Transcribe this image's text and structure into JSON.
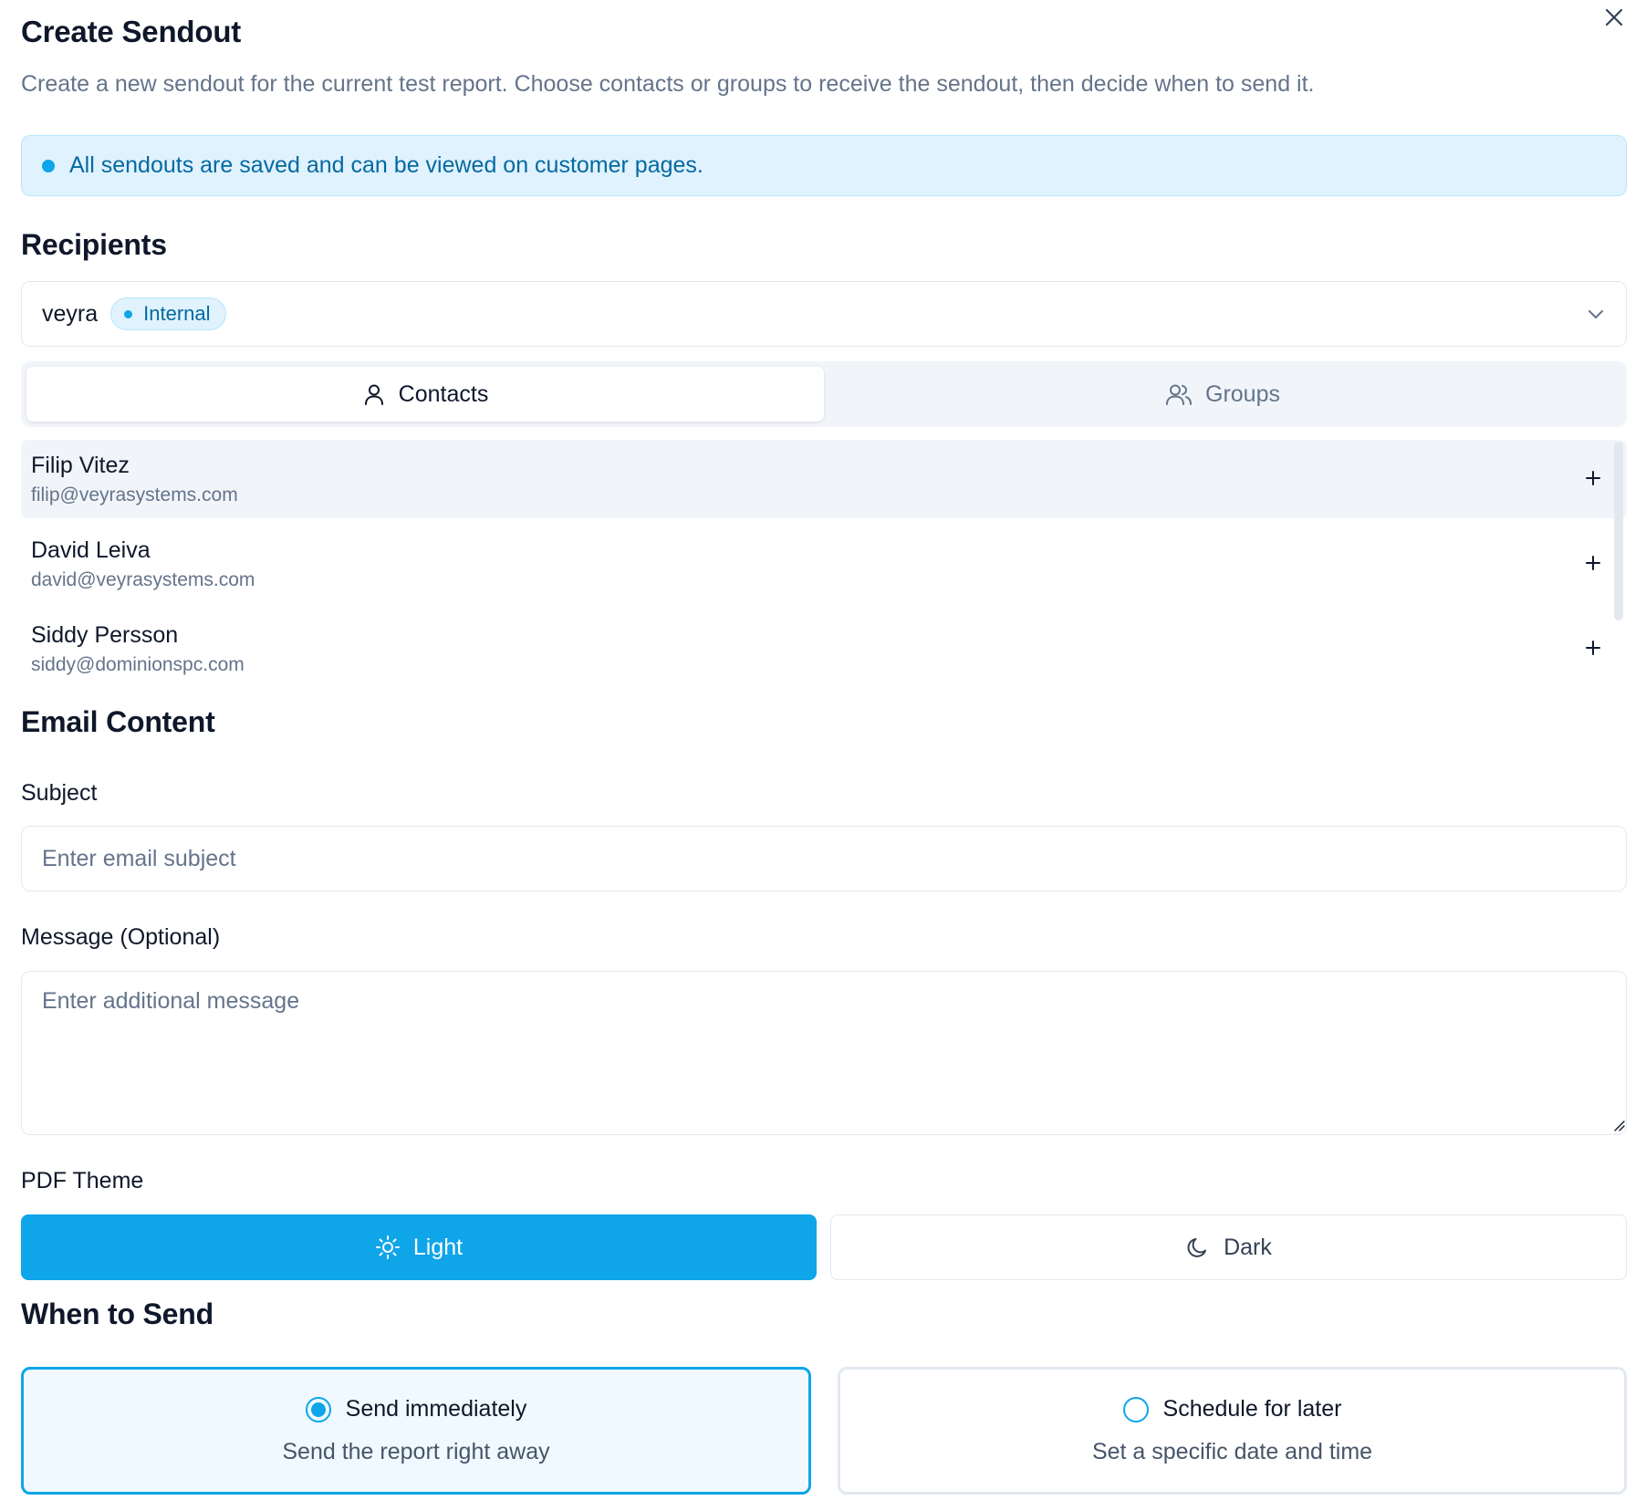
{
  "dialog": {
    "title": "Create Sendout",
    "description": "Create a new sendout for the current test report. Choose contacts or groups to receive the sendout, then decide when to send it.",
    "info_banner": "All sendouts are saved and can be viewed on customer pages."
  },
  "recipients": {
    "heading": "Recipients",
    "selected_org": "veyra",
    "org_badge": "Internal",
    "tabs": [
      {
        "label": "Contacts",
        "icon": "user-icon",
        "active": true
      },
      {
        "label": "Groups",
        "icon": "users-icon",
        "active": false
      }
    ],
    "contacts": [
      {
        "name": "Filip Vitez",
        "email": "filip@veyrasystems.com"
      },
      {
        "name": "David Leiva",
        "email": "david@veyrasystems.com"
      },
      {
        "name": "Siddy Persson",
        "email": "siddy@dominionspc.com"
      }
    ]
  },
  "email_content": {
    "heading": "Email Content",
    "subject_label": "Subject",
    "subject_placeholder": "Enter email subject",
    "subject_value": "",
    "message_label": "Message (Optional)",
    "message_placeholder": "Enter additional message",
    "message_value": ""
  },
  "pdf_theme": {
    "label": "PDF Theme",
    "options": [
      {
        "label": "Light",
        "icon": "sun-icon",
        "selected": true
      },
      {
        "label": "Dark",
        "icon": "moon-icon",
        "selected": false
      }
    ]
  },
  "when_to_send": {
    "heading": "When to Send",
    "options": [
      {
        "title": "Send immediately",
        "description": "Send the report right away",
        "selected": true
      },
      {
        "title": "Schedule for later",
        "description": "Set a specific date and time",
        "selected": false
      }
    ]
  },
  "colors": {
    "accent": "#0ea5e9",
    "info_bg": "#e0f2fe",
    "info_text": "#0369a1",
    "muted_text": "#64748b",
    "border": "#e2e8f0"
  }
}
